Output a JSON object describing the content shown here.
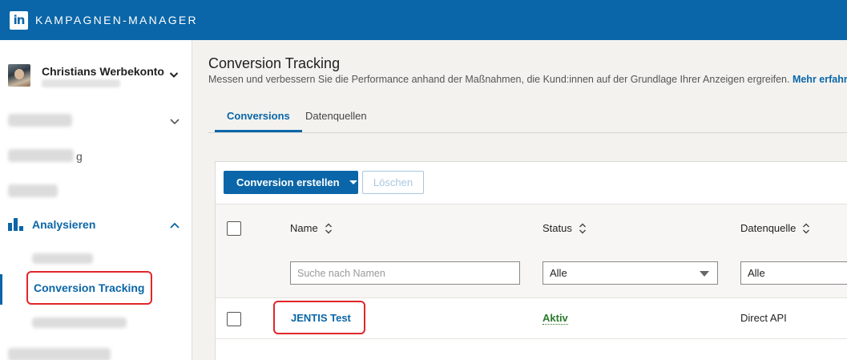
{
  "header": {
    "logo_text": "in",
    "app_title": "KAMPAGNEN-MANAGER"
  },
  "sidebar": {
    "account_name": "Christians Werbekonto",
    "fragment_1": "g",
    "analyze_label": "Analysieren",
    "active_item": "Conversion Tracking"
  },
  "main": {
    "title": "Conversion Tracking",
    "subtitle": "Messen und verbessern Sie die Performance anhand der Maßnahmen, die Kund:innen auf der Grundlage Ihrer Anzeigen ergreifen.",
    "more_link": "Mehr erfahren",
    "tabs": [
      {
        "label": "Conversions",
        "active": true
      },
      {
        "label": "Datenquellen",
        "active": false
      }
    ],
    "toolbar": {
      "create_label": "Conversion erstellen",
      "delete_label": "Löschen"
    },
    "table": {
      "columns": {
        "name": "Name",
        "status": "Status",
        "source": "Datenquelle"
      },
      "search_placeholder": "Suche nach Namen",
      "status_filter": "Alle",
      "source_filter": "Alle",
      "rows": [
        {
          "name": "JENTIS Test",
          "status": "Aktiv",
          "source": "Direct API"
        }
      ]
    }
  },
  "colors": {
    "brand": "#0a66a8",
    "highlight": "#e0262a",
    "active_status": "#2b7a2b"
  }
}
